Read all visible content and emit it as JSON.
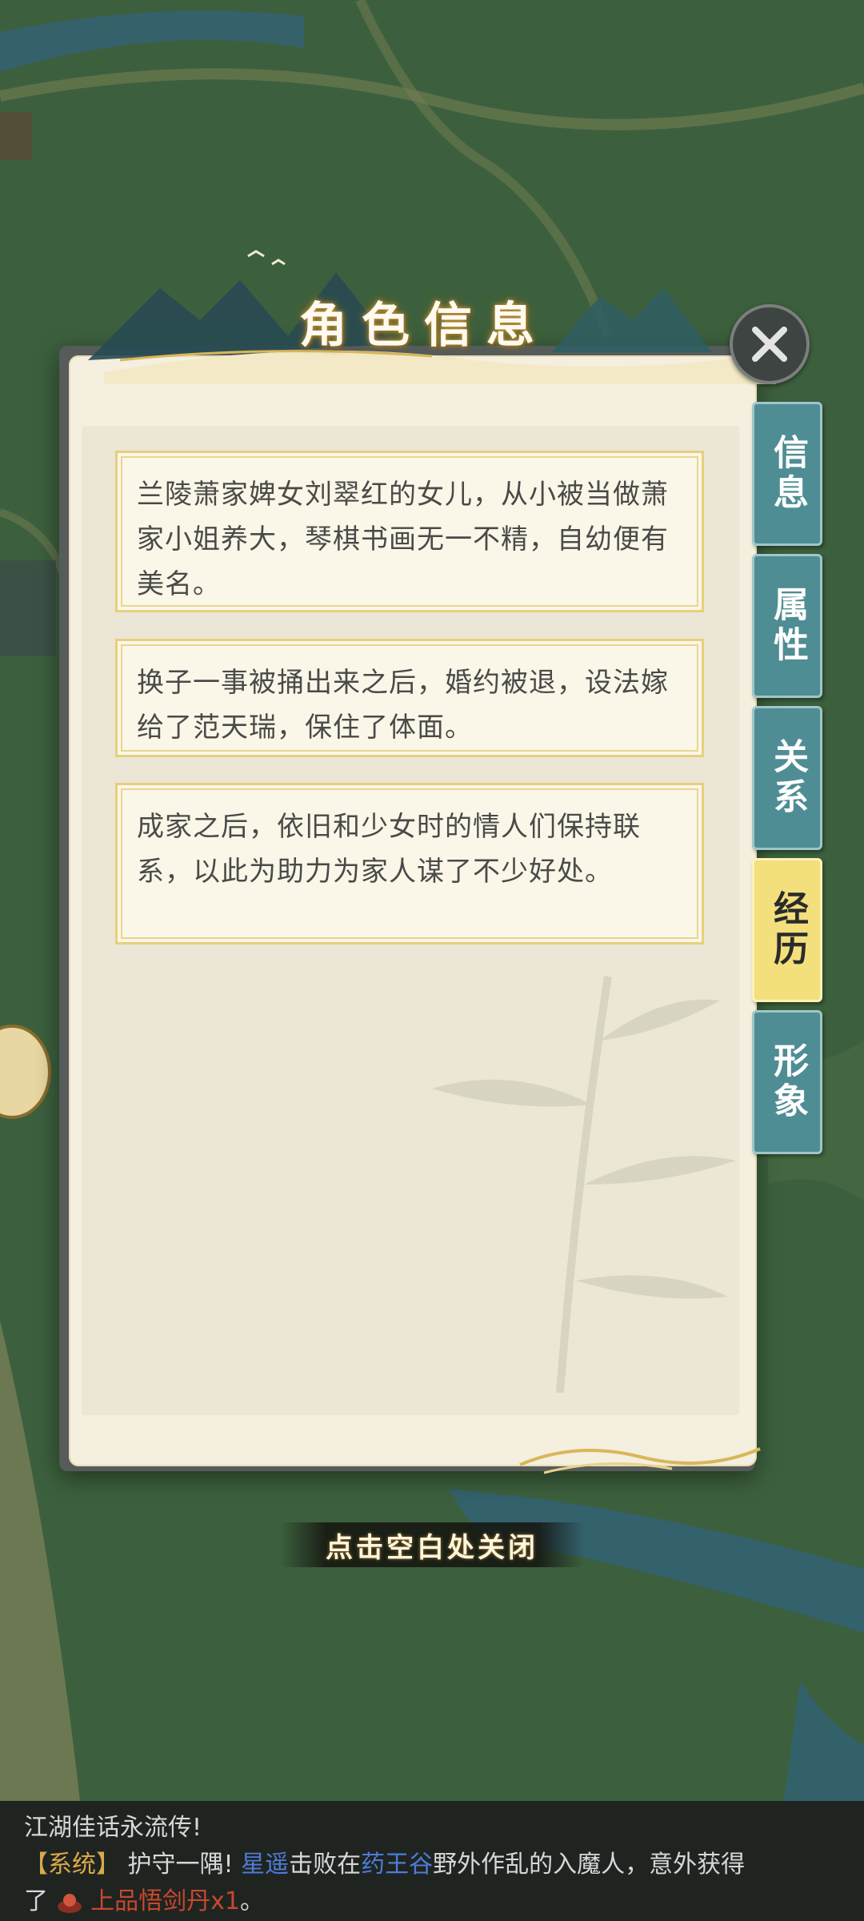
{
  "panel": {
    "title": "角色信息",
    "entries": [
      "兰陵萧家婢女刘翠红的女儿，从小被当做萧家小姐养大，琴棋书画无一不精，自幼便有美名。",
      "换子一事被捅出来之后，婚约被退，设法嫁给了范天瑞，保住了体面。",
      "成家之后，依旧和少女时的情人们保持联系，以此为助力为家人谋了不少好处。"
    ]
  },
  "tabs": [
    {
      "label": "信息",
      "active": false
    },
    {
      "label": "属性",
      "active": false
    },
    {
      "label": "关系",
      "active": false
    },
    {
      "label": "经历",
      "active": true
    },
    {
      "label": "形象",
      "active": false
    }
  ],
  "hint": "点击空白处关闭",
  "chat": {
    "line1": "江湖佳话永流传!",
    "tag": "【系统】",
    "msg_pre": "护守一隅!",
    "player": "星遥",
    "msg_mid": "击败在",
    "location": "药王谷",
    "msg_post": "野外作乱的入魔人，意外获得",
    "msg_line3_pre": "了",
    "item": "上品悟剑丹x1",
    "msg_line3_post": "。"
  },
  "colors": {
    "tab_default": "#4f8d94",
    "tab_active": "#f3df7c",
    "system_tag": "#d8a94a",
    "player_name": "#4d7cd6",
    "item_name": "#c9482e"
  },
  "icons": [
    "close-icon",
    "chat-bubble-icon",
    "pill-icon"
  ]
}
